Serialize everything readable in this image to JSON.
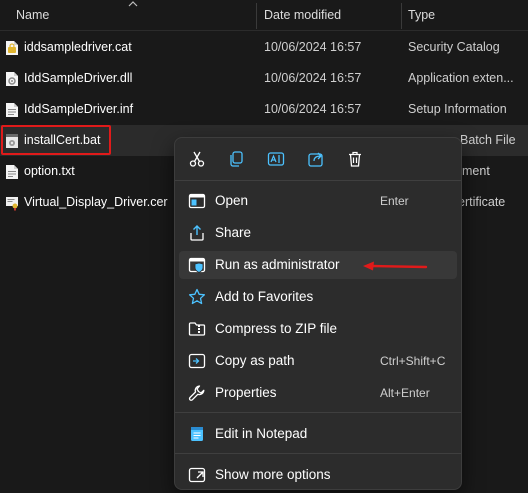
{
  "columns": {
    "name": "Name",
    "date": "Date modified",
    "type": "Type"
  },
  "files": [
    {
      "name": "iddsampledriver.cat",
      "date": "10/06/2024 16:57",
      "type": "Security Catalog",
      "icon": "catalog-file-icon"
    },
    {
      "name": "IddSampleDriver.dll",
      "date": "10/06/2024 16:57",
      "type": "Application exten...",
      "icon": "dll-file-icon"
    },
    {
      "name": "IddSampleDriver.inf",
      "date": "10/06/2024 16:57",
      "type": "Setup Information",
      "icon": "inf-file-icon"
    },
    {
      "name": "installCert.bat",
      "date": "",
      "type": "Batch File",
      "icon": "bat-file-icon"
    },
    {
      "name": "option.txt",
      "date": "",
      "type": "ment",
      "icon": "text-file-icon"
    },
    {
      "name": "Virtual_Display_Driver.cer",
      "date": "",
      "type": "ertificate",
      "icon": "certificate-file-icon"
    }
  ],
  "context_menu": {
    "quick_actions": [
      "Cut",
      "Copy",
      "Rename",
      "Share",
      "Delete"
    ],
    "items": [
      {
        "label": "Open",
        "shortcut": "Enter",
        "icon": "open-icon"
      },
      {
        "label": "Share",
        "shortcut": "",
        "icon": "share-icon"
      },
      {
        "label": "Run as administrator",
        "shortcut": "",
        "icon": "shield-icon"
      },
      {
        "label": "Add to Favorites",
        "shortcut": "",
        "icon": "star-icon"
      },
      {
        "label": "Compress to ZIP file",
        "shortcut": "",
        "icon": "zip-icon"
      },
      {
        "label": "Copy as path",
        "shortcut": "Ctrl+Shift+C",
        "icon": "copy-path-icon"
      },
      {
        "label": "Properties",
        "shortcut": "Alt+Enter",
        "icon": "wrench-icon"
      },
      {
        "label": "Edit in Notepad",
        "shortcut": "",
        "icon": "notepad-icon"
      },
      {
        "label": "Show more options",
        "shortcut": "",
        "icon": "more-options-icon"
      }
    ]
  },
  "colors": {
    "background": "#191919",
    "menu": "#2c2c2c",
    "accent": "#4cc2ff",
    "highlight": "#e01a1a"
  }
}
